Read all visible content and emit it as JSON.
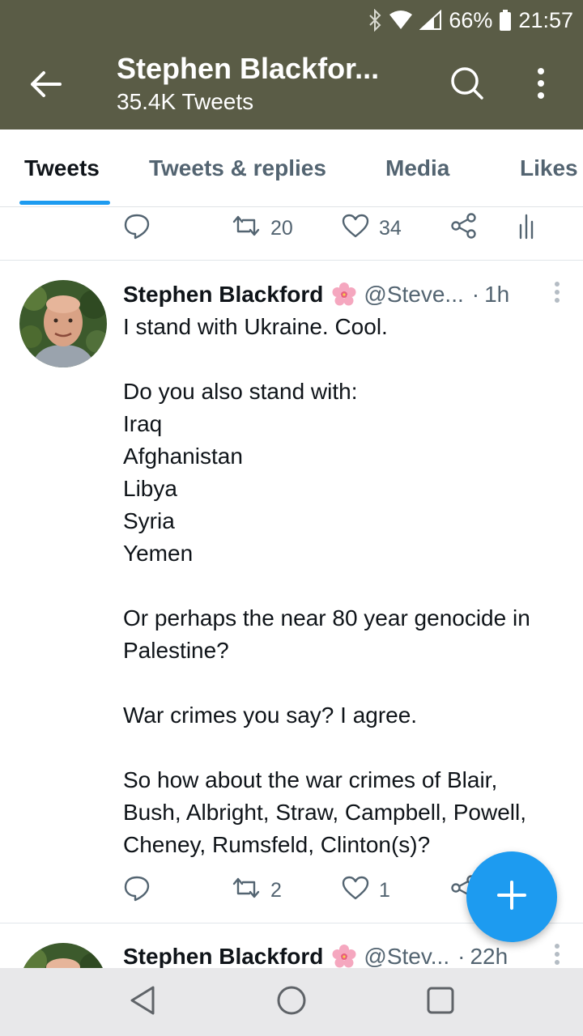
{
  "status_bar": {
    "battery": "66%",
    "time": "21:57"
  },
  "header": {
    "name": "Stephen Blackfor...",
    "tweet_count": "35.4K Tweets"
  },
  "tabs": [
    {
      "label": "Tweets",
      "active": true
    },
    {
      "label": "Tweets & replies",
      "active": false
    },
    {
      "label": "Media",
      "active": false
    },
    {
      "label": "Likes",
      "active": false
    }
  ],
  "prev_tweet_actions": {
    "retweets": "20",
    "likes": "34"
  },
  "tweets": [
    {
      "name": "Stephen Blackford",
      "handle": "@Steve...",
      "time": "1h",
      "lines": [
        "I stand with Ukraine. Cool.",
        "",
        "Do you also stand with:",
        "Iraq",
        "Afghanistan",
        "Libya",
        "Syria",
        "Yemen",
        "",
        "Or perhaps the near 80 year genocide in",
        "Palestine?",
        "",
        "War crimes you say? I agree.",
        "",
        "So how about the war crimes of Blair,",
        "Bush, Albright, Straw, Campbell, Powell,",
        "Cheney, Rumsfeld, Clinton(s)?"
      ],
      "retweets": "2",
      "likes": "1"
    },
    {
      "name": "Stephen Blackford",
      "handle": "@Stev...",
      "time": "22h"
    }
  ],
  "colors": {
    "header_bg": "#5a5c46",
    "accent": "#1d9bf0",
    "muted": "#536471"
  }
}
